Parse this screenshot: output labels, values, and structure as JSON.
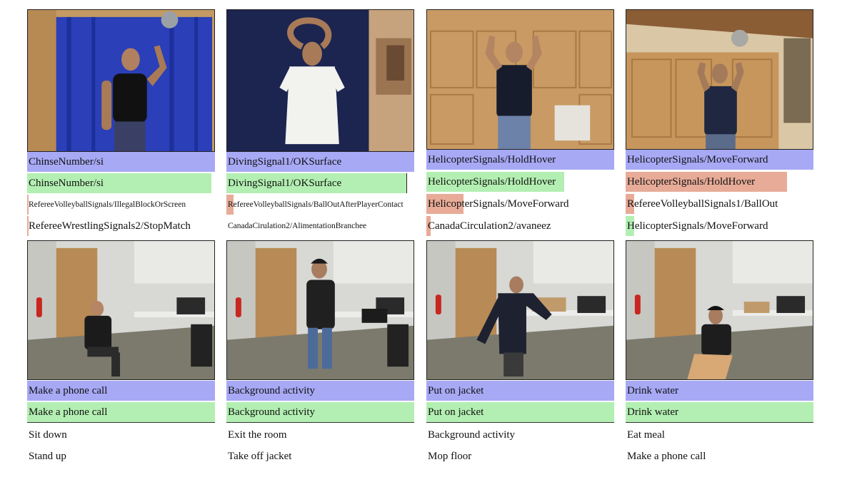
{
  "colors": {
    "top1": "#a7a9f5",
    "gt": "#b3efb2",
    "wrong": "#e7ab98"
  },
  "top_row": [
    {
      "scene": "blue-backdrop gesture",
      "predictions": [
        {
          "label": "ChinseNumber/si",
          "score": 1.0,
          "kind": "top1"
        },
        {
          "label": "ChinseNumber/si",
          "score": 0.98,
          "kind": "gt"
        },
        {
          "label": "RefereeVolleyballSignals/IllegalBlockOrScreen",
          "score": 0.005,
          "kind": "wrong"
        },
        {
          "label": "RefereeWrestlingSignals2/StopMatch",
          "score": 0.005,
          "kind": "wrong"
        }
      ]
    },
    {
      "scene": "arms over head",
      "predictions": [
        {
          "label": "DivingSignal1/OKSurface",
          "score": 1.0,
          "kind": "top1"
        },
        {
          "label": "DivingSignal1/OKSurface",
          "score": 0.96,
          "kind": "gt"
        },
        {
          "label": "RefereeVolleyballSignals/BallOutAfterPlayerContact",
          "score": 0.04,
          "kind": "wrong"
        },
        {
          "label": "CanadaCirulation2/AlimentationBranchee",
          "score": 0.0,
          "kind": "wrong"
        }
      ]
    },
    {
      "scene": "helicopter hold hover",
      "predictions": [
        {
          "label": "HelicopterSignals/HoldHover",
          "score": 1.0,
          "kind": "top1"
        },
        {
          "label": "HelicopterSignals/HoldHover",
          "score": 0.73,
          "kind": "gt"
        },
        {
          "label": "HelicopterSignals/MoveForward",
          "score": 0.2,
          "kind": "wrong"
        },
        {
          "label": "CanadaCirculation2/avaneez",
          "score": 0.02,
          "kind": "wrong"
        }
      ]
    },
    {
      "scene": "helicopter move forward",
      "predictions": [
        {
          "label": "HelicopterSignals/MoveForward",
          "score": 1.0,
          "kind": "top1"
        },
        {
          "label": "HelicopterSignals/HoldHover",
          "score": 0.86,
          "kind": "wrong"
        },
        {
          "label": "RefereeVolleyballSignals1/BallOut",
          "score": 0.05,
          "kind": "wrong"
        },
        {
          "label": "HelicopterSignals/MoveForward",
          "score": 0.05,
          "kind": "gt"
        }
      ]
    }
  ],
  "bottom_row": [
    {
      "scene": "office sitting",
      "predictions": [
        {
          "label": "Make a phone call",
          "score": 1.0,
          "kind": "top1"
        },
        {
          "label": "Make a phone call",
          "score": 1.0,
          "kind": "gt"
        },
        {
          "label": "Sit down",
          "score": 0.0,
          "kind": "wrong"
        },
        {
          "label": "Stand up",
          "score": 0.0,
          "kind": "wrong"
        }
      ]
    },
    {
      "scene": "office standing",
      "predictions": [
        {
          "label": "Background activity",
          "score": 1.0,
          "kind": "top1"
        },
        {
          "label": "Background activity",
          "score": 1.0,
          "kind": "gt"
        },
        {
          "label": "Exit the room",
          "score": 0.0,
          "kind": "wrong"
        },
        {
          "label": "Take off jacket",
          "score": 0.0,
          "kind": "wrong"
        }
      ]
    },
    {
      "scene": "office jacket",
      "predictions": [
        {
          "label": "Put on jacket",
          "score": 1.0,
          "kind": "top1"
        },
        {
          "label": "Put on jacket",
          "score": 1.0,
          "kind": "gt"
        },
        {
          "label": "Background activity",
          "score": 0.0,
          "kind": "wrong"
        },
        {
          "label": "Mop floor",
          "score": 0.0,
          "kind": "wrong"
        }
      ]
    },
    {
      "scene": "office drinking",
      "predictions": [
        {
          "label": "Drink water",
          "score": 1.0,
          "kind": "top1"
        },
        {
          "label": "Drink water",
          "score": 1.0,
          "kind": "gt"
        },
        {
          "label": "Eat meal",
          "score": 0.0,
          "kind": "wrong"
        },
        {
          "label": "Make a phone call",
          "score": 0.0,
          "kind": "wrong"
        }
      ]
    }
  ]
}
